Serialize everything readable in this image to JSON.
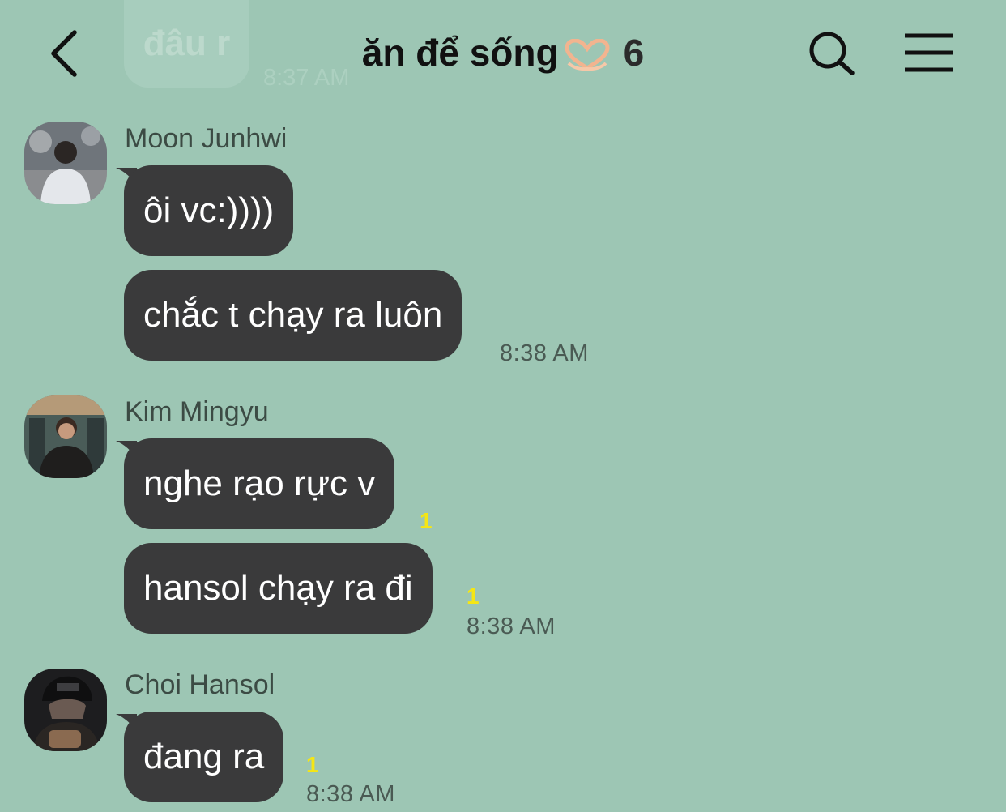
{
  "previous": {
    "text": "đâu r",
    "time": "8:37 AM"
  },
  "header": {
    "title": "ăn để sống",
    "member_count": "6"
  },
  "messages": [
    {
      "sender": "Moon Junhwi",
      "bubbles": [
        {
          "text": "ôi vc:))))"
        },
        {
          "text": "chắc t chạy ra luôn",
          "time": "8:38 AM"
        }
      ]
    },
    {
      "sender": "Kim Mingyu",
      "bubbles": [
        {
          "text": "nghe rạo rực v",
          "unread": "1"
        },
        {
          "text": "hansol chạy ra đi",
          "unread": "1",
          "time": "8:38 AM"
        }
      ]
    },
    {
      "sender": "Choi Hansol",
      "bubbles": [
        {
          "text": "đang ra",
          "unread": "1",
          "time": "8:38 AM"
        }
      ]
    }
  ],
  "colors": {
    "background": "#9dc6b4",
    "bubble": "#3a3a3b",
    "unread": "#f5e614"
  }
}
